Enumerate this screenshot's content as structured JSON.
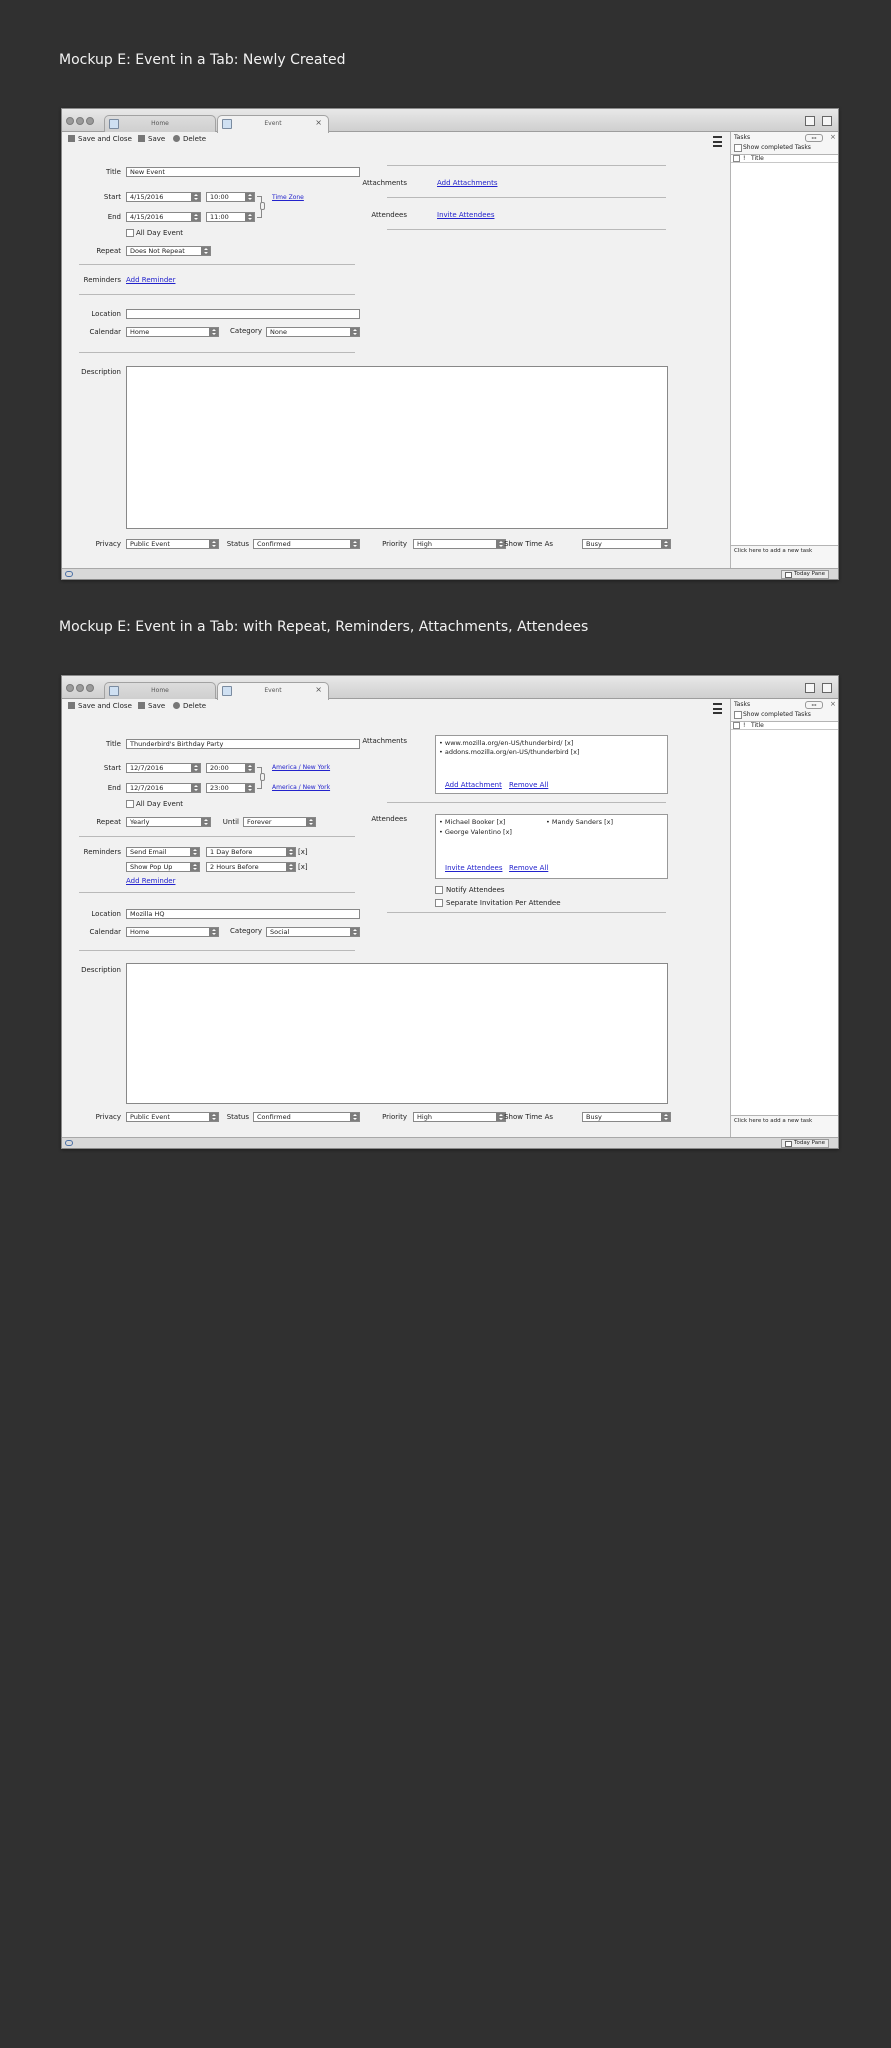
{
  "mockups": [
    {
      "title": "Mockup E: Event in a Tab: Newly Created",
      "tabs": [
        "Home",
        "Event"
      ],
      "toolbar": {
        "save_close": "Save and Close",
        "save": "Save",
        "delete": "Delete"
      },
      "form": {
        "title_label": "Title",
        "title_value": "New Event",
        "start_label": "Start",
        "start_date": "4/15/2016",
        "start_time": "10:00",
        "end_label": "End",
        "end_date": "4/15/2016",
        "end_time": "11:00",
        "timezone_link": "Time Zone",
        "allday_label": "All Day Event",
        "repeat_label": "Repeat",
        "repeat_value": "Does Not Repeat",
        "reminders_label": "Reminders",
        "add_reminder": "Add Reminder",
        "location_label": "Location",
        "location_value": "",
        "calendar_label": "Calendar",
        "calendar_value": "Home",
        "category_label": "Category",
        "category_value": "None",
        "description_label": "Description",
        "privacy_label": "Privacy",
        "privacy_value": "Public Event",
        "status_label": "Status",
        "status_value": "Confirmed",
        "priority_label": "Priority",
        "priority_value": "High",
        "showtime_label": "Show Time As",
        "showtime_value": "Busy",
        "attachments_label": "Attachments",
        "add_attachments": "Add Attachments",
        "attendees_label": "Attendees",
        "invite_attendees": "Invite Attendees"
      },
      "tasks": {
        "header": "Tasks",
        "show_completed": "Show completed Tasks",
        "col_title": "Title",
        "add_task": "Click here to add a new task",
        "today_pane": "Today Pane"
      }
    },
    {
      "title": "Mockup E: Event in a Tab: with Repeat, Reminders, Attachments, Attendees",
      "tabs": [
        "Home",
        "Event"
      ],
      "toolbar": {
        "save_close": "Save and Close",
        "save": "Save",
        "delete": "Delete"
      },
      "form": {
        "title_label": "Title",
        "title_value": "Thunderbird's Birthday Party",
        "start_label": "Start",
        "start_date": "12/7/2016",
        "start_time": "20:00",
        "end_label": "End",
        "end_date": "12/7/2016",
        "end_time": "23:00",
        "start_tz": "America / New York",
        "end_tz": "America  / New York",
        "allday_label": "All Day Event",
        "repeat_label": "Repeat",
        "repeat_value": "Yearly",
        "until_label": "Until",
        "until_value": "Forever",
        "reminders_label": "Reminders",
        "reminder1_type": "Send Email",
        "reminder1_time": "1 Day Before",
        "reminder2_type": "Show Pop Up",
        "reminder2_time": "2 Hours Before",
        "remove_mark": "[x]",
        "add_reminder": "Add Reminder",
        "location_label": "Location",
        "location_value": "Mozilla HQ",
        "calendar_label": "Calendar",
        "calendar_value": "Home",
        "category_label": "Category",
        "category_value": "Social",
        "description_label": "Description",
        "privacy_label": "Privacy",
        "privacy_value": "Public Event",
        "status_label": "Status",
        "status_value": "Confirmed",
        "priority_label": "Priority",
        "priority_value": "High",
        "showtime_label": "Show Time As",
        "showtime_value": "Busy",
        "attachments_label": "Attachments",
        "attachment1": "• www.mozilla.org/en-US/thunderbird/  [x]",
        "attachment2": "• addons.mozilla.org/en-US/thunderbird [x]",
        "add_attachment": "Add Attachment",
        "remove_all_att": "Remove All",
        "attendees_label": "Attendees",
        "attendee1": "• Michael Booker [x]",
        "attendee2": "• Mandy Sanders [x]",
        "attendee3": "• George Valentino [x]",
        "invite_attendees": "Invite Attendees",
        "remove_all_att2": "Remove All",
        "notify_label": "Notify Attendees",
        "separate_label": "Separate Invitation Per Attendee"
      },
      "tasks": {
        "header": "Tasks",
        "show_completed": "Show completed Tasks",
        "col_title": "Title",
        "add_task": "Click here to add a new task",
        "today_pane": "Today Pane"
      }
    }
  ]
}
